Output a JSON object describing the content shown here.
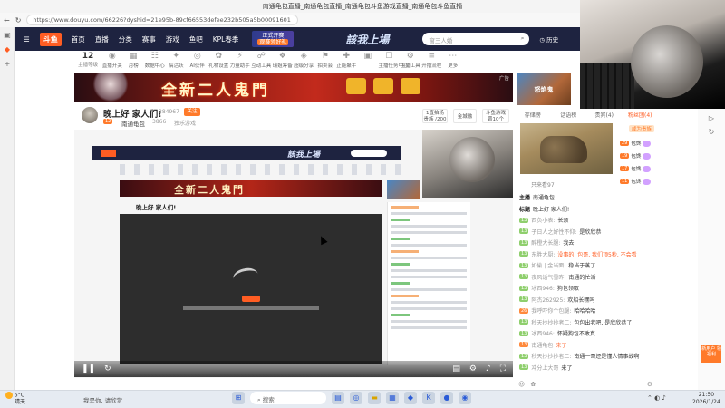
{
  "browser": {
    "title": "南通龟包直播_南通龟包直播_南通龟包斗鱼游戏直播_南通龟包斗鱼直播",
    "url": "https://www.douyu.com/66226?dyshid=21e95b-89cf66553defee232b505a5b00091601"
  },
  "header": {
    "logo": "斗鱼",
    "nav": [
      "首页",
      "直播",
      "分类",
      "赛事",
      "游戏",
      "鱼吧",
      "KPL春季"
    ],
    "promo_line1": "正式开赛",
    "promo_line2": "观赛领好礼",
    "slogan": "該我上場",
    "search_placeholder": "窗三人婚",
    "history_label": "历史"
  },
  "level": {
    "value": "12",
    "sub": "主播等级"
  },
  "icon_row": [
    "直播开关",
    "月榜",
    "数据中心",
    "搞活跃",
    "AI伙伴",
    "礼物设置",
    "力量助手",
    "互动工具",
    "瑞姐筹备",
    "超级分享",
    "拍卖会",
    "正能聚手",
    "",
    "主播任务中心",
    "主播工具",
    "开播流程",
    "更多"
  ],
  "banner": {
    "text": "全新二人鬼門",
    "ad": "广告"
  },
  "side_ad": "怒焰鬼",
  "room": {
    "title": "晚上好 家人们!",
    "room_id": "384967",
    "follow": "关注",
    "badge": "12",
    "host": "南通龟包",
    "fans": "3866",
    "category": "独乐游戏",
    "box1_line1": "1直拍场",
    "box1_line2": "贵族 /200",
    "box2_line1": "金城融",
    "box3_line1": "斗鱼游戏",
    "box3_line2": "晋10个"
  },
  "right_tabs": [
    {
      "label": "存储榜",
      "active": false
    },
    {
      "label": "话语榜",
      "active": false
    },
    {
      "label": "贵宾(4)",
      "active": false
    },
    {
      "label": "粉丝团(4)",
      "active": true
    }
  ],
  "grow_tag": "成为贵族",
  "rank_rows": [
    {
      "lv": "29",
      "name": "包馋"
    },
    {
      "lv": "19",
      "name": "包馋"
    },
    {
      "lv": "17",
      "name": "包馋"
    },
    {
      "lv": "11",
      "name": "包馋"
    }
  ],
  "watchers": "只来看97",
  "chat": [
    {
      "lv": "",
      "user": "主播",
      "text": "南通龟包",
      "type": "plain"
    },
    {
      "lv": "",
      "user": "标题",
      "text": "晚上好 家人们!",
      "type": "title"
    },
    {
      "lv": "13",
      "user": "西负小表:",
      "text": "长颈",
      "type": "g"
    },
    {
      "lv": "13",
      "user": "子日人之好性不仰:",
      "text": "是欣欣恭",
      "type": "g"
    },
    {
      "lv": "13",
      "user": "醉橙大长腿:",
      "text": "我去",
      "type": "g"
    },
    {
      "lv": "13",
      "user": "东胜大厨:",
      "text": "没事的, 包哥, 我们顶5秒, 不会看",
      "type": "red"
    },
    {
      "lv": "13",
      "user": "如偷 | 金当面:",
      "text": "稳当于蒸了",
      "type": "g"
    },
    {
      "lv": "13",
      "user": "夜风话气雪昨:",
      "text": "南通的忙活",
      "type": "g"
    },
    {
      "lv": "13",
      "user": "冰西946:",
      "text": "狗包领取",
      "type": "g"
    },
    {
      "lv": "13",
      "user": "阿杰262925:",
      "text": "欢船长嘿吗",
      "type": "g"
    },
    {
      "lv": "26",
      "user": "我呼吓你个包腿:",
      "text": "哈哈哈哈",
      "type": "o"
    },
    {
      "lv": "13",
      "user": "秒天抄抄抄者二:",
      "text": "包包出老吧, 是欣欣恭了",
      "type": "g"
    },
    {
      "lv": "13",
      "user": "冰西946:",
      "text": "怀疑狗包不敢真",
      "type": "g"
    },
    {
      "lv": "13",
      "user": "南通龟包",
      "text": "来了",
      "type": "host"
    },
    {
      "lv": "13",
      "user": "秒天抄抄抄者二:",
      "text": "南通一哥还是懂人情事故啊",
      "type": "g"
    },
    {
      "lv": "13",
      "user": "冲分上大哥",
      "text": "来了",
      "type": "g"
    }
  ],
  "taskbar": {
    "weather_temp": "5°C",
    "weather_desc": "晴天",
    "message": "我是你, 请欣赏",
    "search": "搜索",
    "time": "21:50",
    "date": "2026/1/24"
  },
  "right_rail_promo": "新用户\n领福利"
}
